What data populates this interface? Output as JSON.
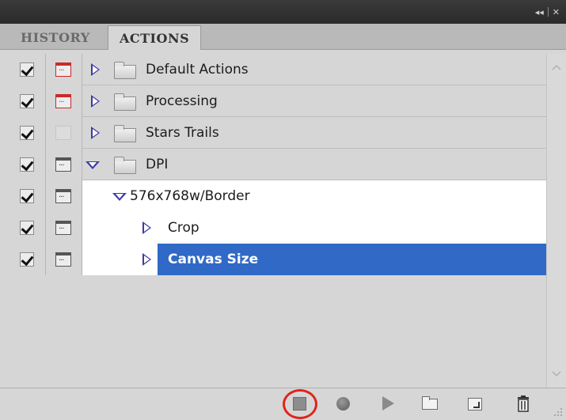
{
  "tabs": [
    {
      "label": "HISTORY",
      "active": false
    },
    {
      "label": "ACTIONS",
      "active": true
    }
  ],
  "actions": [
    {
      "label": "Default Actions",
      "checked": true,
      "dialog": "red",
      "type": "set",
      "expanded": false
    },
    {
      "label": "Processing",
      "checked": true,
      "dialog": "red",
      "type": "set",
      "expanded": false
    },
    {
      "label": "Stars Trails",
      "checked": true,
      "dialog": "none",
      "type": "set",
      "expanded": false
    },
    {
      "label": "DPI",
      "checked": true,
      "dialog": "on",
      "type": "set",
      "expanded": true
    },
    {
      "label": "576x768w/Border",
      "checked": true,
      "dialog": "on",
      "type": "action",
      "expanded": true
    },
    {
      "label": "Crop",
      "checked": true,
      "dialog": "on",
      "type": "step",
      "expanded": false
    },
    {
      "label": "Canvas Size",
      "checked": true,
      "dialog": "on",
      "type": "step",
      "expanded": false,
      "selected": true
    }
  ],
  "toolbar": {
    "buttons": [
      "stop-icon",
      "record-icon",
      "play-icon",
      "new-set-folder-icon",
      "new-action-icon",
      "trash-icon"
    ],
    "highlighted": "stop-icon",
    "highlight_color": "#e0241a"
  },
  "colors": {
    "selection": "#3169c6",
    "triangle": "#3b3ba8",
    "red_dialog": "#c92a2a"
  }
}
